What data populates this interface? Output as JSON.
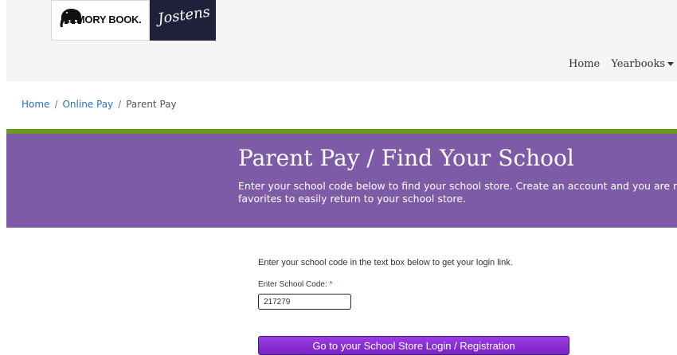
{
  "logos": {
    "memory_book": "MEMORY BOOK.",
    "jostens": "Jostens"
  },
  "nav": {
    "home": "Home",
    "yearbooks": "Yearbooks"
  },
  "breadcrumb": {
    "home": "Home",
    "online_pay": "Online Pay",
    "current": "Parent Pay",
    "separator": "/"
  },
  "hero": {
    "title": "Parent Pay / Find Your School",
    "desc_line1": "Enter your school code below to find your school store. Create an account and you are read",
    "desc_line2": "favorites to easily return to your school store."
  },
  "form": {
    "instruction": "Enter your school code in the text box below to get your login link.",
    "code_label": "Enter School Code:",
    "required_mark": "*",
    "code_value": "217279",
    "submit_label": "Go to your School Store Login / Registration"
  },
  "colors": {
    "hero_bg": "#7d5ba6",
    "hero_border": "#6b9a1f",
    "link": "#2a72b7",
    "button": "#8a2fd6"
  }
}
